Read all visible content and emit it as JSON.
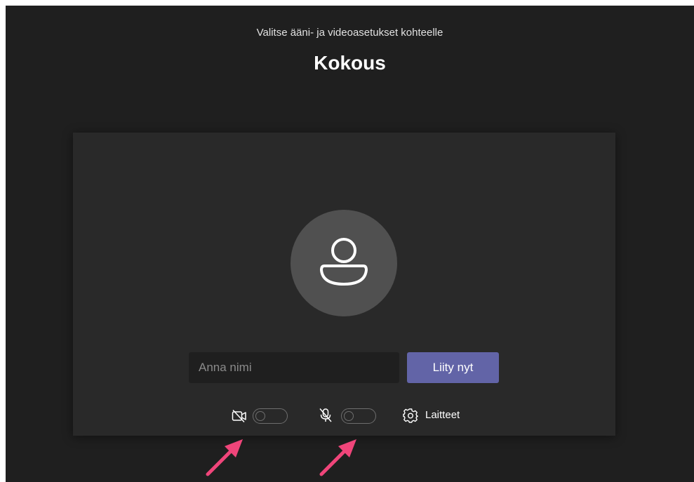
{
  "header": {
    "subtitle": "Valitse ääni- ja videoasetukset kohteelle",
    "meeting_title": "Kokous"
  },
  "prejoin": {
    "avatar_icon": "person-icon",
    "name_input": {
      "value": "",
      "placeholder": "Anna nimi"
    },
    "join_button_label": "Liity nyt",
    "controls": {
      "camera": {
        "icon": "camera-off-icon",
        "toggle_on": false
      },
      "microphone": {
        "icon": "mic-off-icon",
        "toggle_on": false
      },
      "devices": {
        "icon": "gear-icon",
        "label": "Laitteet"
      }
    }
  },
  "annotations": {
    "arrow_color": "#f0457a",
    "arrows": [
      "camera-toggle-arrow",
      "mic-toggle-arrow"
    ]
  },
  "colors": {
    "background": "#1f1f1f",
    "panel": "#292929",
    "accent": "#6264a7",
    "avatar": "#505050"
  }
}
